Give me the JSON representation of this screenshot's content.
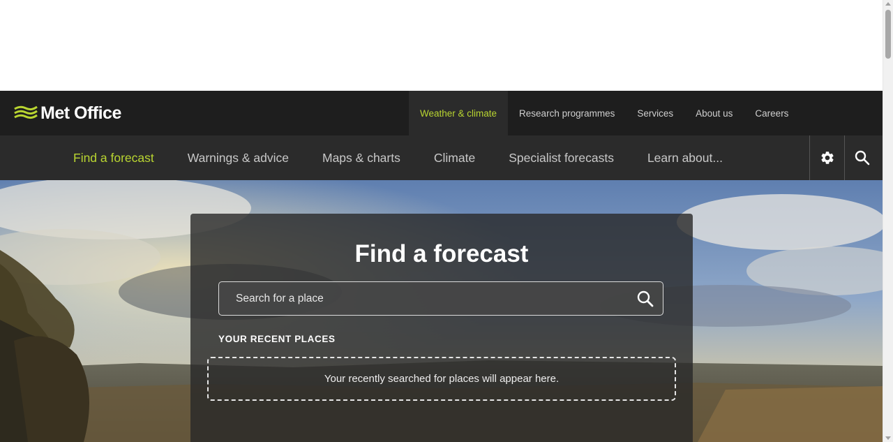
{
  "brand": {
    "name": "Met Office",
    "accent_color": "#b9d531",
    "header_bg": "#1e1e1e",
    "nav_bg": "#2b2b2b"
  },
  "top_nav": {
    "items": [
      {
        "label": "Weather & climate",
        "active": true
      },
      {
        "label": "Research programmes",
        "active": false
      },
      {
        "label": "Services",
        "active": false
      },
      {
        "label": "About us",
        "active": false
      },
      {
        "label": "Careers",
        "active": false
      }
    ]
  },
  "main_nav": {
    "items": [
      {
        "label": "Find a forecast",
        "active": true
      },
      {
        "label": "Warnings & advice",
        "active": false
      },
      {
        "label": "Maps & charts",
        "active": false
      },
      {
        "label": "Climate",
        "active": false
      },
      {
        "label": "Specialist forecasts",
        "active": false
      },
      {
        "label": "Learn about...",
        "active": false
      }
    ],
    "settings_icon": "gear-icon",
    "search_icon": "search-icon"
  },
  "forecast": {
    "title": "Find a forecast",
    "search_placeholder": "Search for a place",
    "recent_heading": "YOUR RECENT PLACES",
    "recent_empty": "Your recently searched for places will appear here."
  }
}
